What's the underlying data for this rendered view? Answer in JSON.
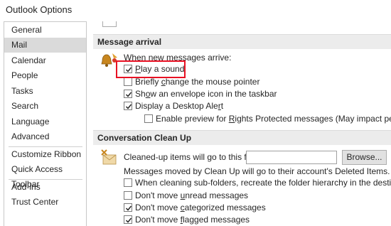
{
  "window": {
    "title": "Outlook Options"
  },
  "nav": {
    "items": [
      {
        "label": "General"
      },
      {
        "label": "Mail",
        "selected": true
      },
      {
        "label": "Calendar"
      },
      {
        "label": "People"
      },
      {
        "label": "Tasks"
      },
      {
        "label": "Search"
      },
      {
        "label": "Language"
      },
      {
        "label": "Advanced"
      },
      {
        "label": "Customize Ribbon"
      },
      {
        "label": "Quick Access Toolbar"
      },
      {
        "label": "Add-ins"
      },
      {
        "label": "Trust Center"
      }
    ]
  },
  "message_arrival": {
    "header": "Message arrival",
    "intro_prefix": "When ",
    "intro_hidden": "new messages",
    "intro_suffix": " arrive:",
    "options": {
      "play_sound": {
        "pre": "",
        "key": "P",
        "post": "lay a sound",
        "checked": true
      },
      "change_pointer": {
        "pre": "Briefly ",
        "key": "c",
        "post": "hange the mouse pointer",
        "checked": false
      },
      "envelope_icon": {
        "pre": "Sh",
        "key": "o",
        "post": "w an envelope icon in the taskbar",
        "checked": true
      },
      "desktop_alert": {
        "pre": "Display a Desktop Ale",
        "key": "r",
        "post": "t",
        "checked": true
      },
      "rights_preview": {
        "pre": "Enable preview for ",
        "key": "R",
        "post": "ights Protected messages (May impact performance)",
        "checked": false
      }
    }
  },
  "conversation_cleanup": {
    "header": "Conversation Clean Up",
    "folder_label": "Cleaned-up items will go to this folder:",
    "folder_value": "",
    "browse_label": "Browse...",
    "deleted_note": "Messages moved by Clean Up will go to their account's Deleted Items.",
    "options": {
      "subfolders": {
        "pre": "When cleaning sub-folders, recreate the folder hierarchy in the destination folder",
        "key": "",
        "post": "",
        "checked": false
      },
      "unread": {
        "pre": "Don't move ",
        "key": "u",
        "post": "nread messages",
        "checked": false
      },
      "categorized": {
        "pre": "Don't move ",
        "key": "c",
        "post": "ategorized messages",
        "checked": true
      },
      "flagged": {
        "pre": "Don't move ",
        "key": "f",
        "post": "lagged messages",
        "checked": true
      }
    }
  },
  "colors": {
    "highlight": "#e81123",
    "selected_nav": "#dadada",
    "section_bg": "#ececec"
  }
}
